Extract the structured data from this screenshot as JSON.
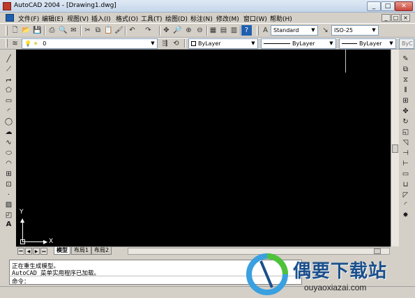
{
  "window": {
    "title": "AutoCAD 2004 - [Drawing1.dwg]",
    "min": "_",
    "max": "□",
    "close": "✕"
  },
  "menu": {
    "items": [
      "文件(F)",
      "编辑(E)",
      "视图(V)",
      "插入(I)",
      "格式(O)",
      "工具(T)",
      "绘图(D)",
      "标注(N)",
      "修改(M)",
      "窗口(W)",
      "帮助(H)"
    ],
    "doc_min": "_",
    "doc_max": "□",
    "doc_close": "×"
  },
  "toolbar": {
    "text_style": "Standard",
    "dim_style": "ISO-25",
    "layer": "0",
    "color": "ByLayer",
    "linetype": "ByLayer",
    "lineweight": "ByLayer",
    "plot_style": "ByC"
  },
  "canvas": {
    "ucs_x": "X",
    "ucs_y": "Y"
  },
  "layout_tabs": [
    "模型",
    "布局1",
    "布局2"
  ],
  "command": {
    "lines": [
      "正在重生成模型。",
      "AutoCAD 菜单实用程序已加载。"
    ],
    "prompt": "命令："
  },
  "watermark": {
    "name": "偶要下载站",
    "url": "ouyaoxiazai.com"
  }
}
